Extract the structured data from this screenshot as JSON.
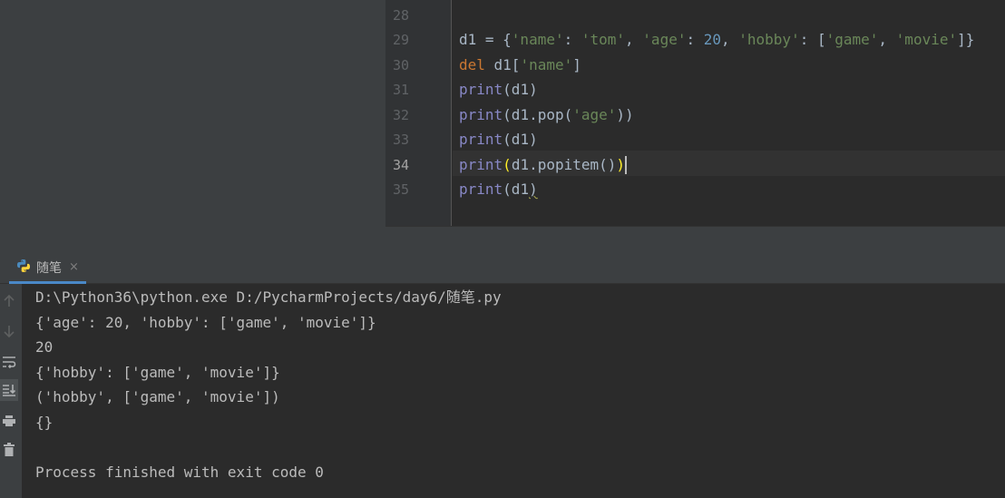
{
  "editor": {
    "lines": [
      {
        "num": "28",
        "text": ""
      },
      {
        "num": "29",
        "text": "d1 = {'name': 'tom', 'age': 20, 'hobby': ['game', 'movie']}"
      },
      {
        "num": "30",
        "text": "del d1['name']"
      },
      {
        "num": "31",
        "text": "print(d1)"
      },
      {
        "num": "32",
        "text": "print(d1.pop('age'))"
      },
      {
        "num": "33",
        "text": "print(d1)"
      },
      {
        "num": "34",
        "text": "print(d1.popitem())"
      },
      {
        "num": "35",
        "text": "print(d1)"
      }
    ],
    "current_line": "34"
  },
  "run_panel": {
    "tab_label": "随笔",
    "tab_icon": "python-icon",
    "tab_close": "×",
    "tools": [
      "arrow-up-icon",
      "arrow-down-icon",
      "soft-wrap-icon",
      "scroll-to-end-icon",
      "print-icon",
      "trash-icon"
    ]
  },
  "console": {
    "lines": [
      "D:\\Python36\\python.exe D:/PycharmProjects/day6/随笔.py",
      "{'age': 20, 'hobby': ['game', 'movie']}",
      "20",
      "{'hobby': ['game', 'movie']}",
      "('hobby', ['game', 'movie'])",
      "{}",
      "",
      "Process finished with exit code 0"
    ]
  },
  "colors": {
    "keyword": "#cc7832",
    "string": "#6a8759",
    "number": "#6897bb",
    "builtin": "#8888c6",
    "brace_highlight": "#ffef28",
    "console_text": "#bbbbbb",
    "background": "#2b2b2b"
  }
}
